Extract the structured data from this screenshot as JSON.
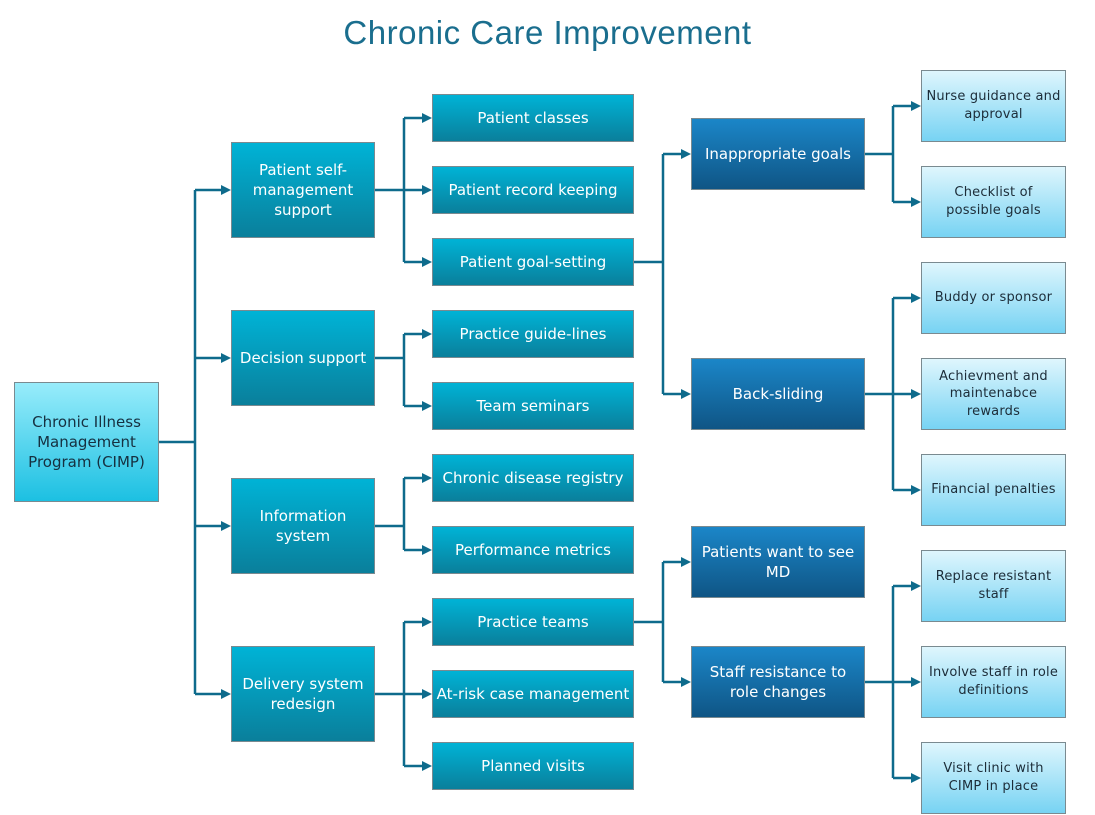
{
  "title": "Chronic Care Improvement",
  "colors": {
    "title": "#1a6e8e",
    "connector": "#0e6b8c",
    "root_fill": "#49d2ee",
    "category_fill": "#0a9bbd",
    "issue_fill": "#1670a8",
    "solution_fill": "#a9e6f9"
  },
  "root": {
    "id": "cimp",
    "label": "Chronic Illness Management Program (CIMP)"
  },
  "categories": [
    {
      "id": "self-mgmt",
      "label": "Patient self-management support"
    },
    {
      "id": "decision",
      "label": "Decision support"
    },
    {
      "id": "info",
      "label": "Information system"
    },
    {
      "id": "delivery",
      "label": "Delivery system redesign"
    }
  ],
  "actions": [
    {
      "id": "classes",
      "label": "Patient classes",
      "parent": "self-mgmt"
    },
    {
      "id": "record",
      "label": "Patient record keeping",
      "parent": "self-mgmt"
    },
    {
      "id": "goal",
      "label": "Patient goal-setting",
      "parent": "self-mgmt"
    },
    {
      "id": "guidelines",
      "label": "Practice guide-lines",
      "parent": "decision"
    },
    {
      "id": "seminars",
      "label": "Team seminars",
      "parent": "decision"
    },
    {
      "id": "registry",
      "label": "Chronic disease registry",
      "parent": "info"
    },
    {
      "id": "metrics",
      "label": "Performance metrics",
      "parent": "info"
    },
    {
      "id": "teams",
      "label": "Practice teams",
      "parent": "delivery"
    },
    {
      "id": "atrisk",
      "label": "At-risk case management",
      "parent": "delivery"
    },
    {
      "id": "visits",
      "label": "Planned visits",
      "parent": "delivery"
    }
  ],
  "issues": [
    {
      "id": "inappropriate",
      "label": "Inappropriate goals",
      "parent": "goal"
    },
    {
      "id": "backsliding",
      "label": "Back-sliding",
      "parent": "goal"
    },
    {
      "id": "wantmd",
      "label": "Patients want to see MD",
      "parent": "teams"
    },
    {
      "id": "resistance",
      "label": "Staff resistance to role changes",
      "parent": "teams"
    }
  ],
  "solutions": [
    {
      "id": "nurse",
      "label": "Nurse guidance and approval",
      "parent": "inappropriate"
    },
    {
      "id": "checklist",
      "label": "Checklist of possible goals",
      "parent": "inappropriate"
    },
    {
      "id": "buddy",
      "label": "Buddy or sponsor",
      "parent": "backsliding"
    },
    {
      "id": "rewards",
      "label": "Achievment and maintenabce rewards",
      "parent": "backsliding"
    },
    {
      "id": "penalties",
      "label": "Financial penalties",
      "parent": "backsliding"
    },
    {
      "id": "replace",
      "label": "Replace resistant staff",
      "parent": "resistance"
    },
    {
      "id": "involve",
      "label": "Involve staff in role definitions",
      "parent": "resistance"
    },
    {
      "id": "clinic",
      "label": "Visit clinic with CIMP in place",
      "parent": "resistance"
    }
  ]
}
